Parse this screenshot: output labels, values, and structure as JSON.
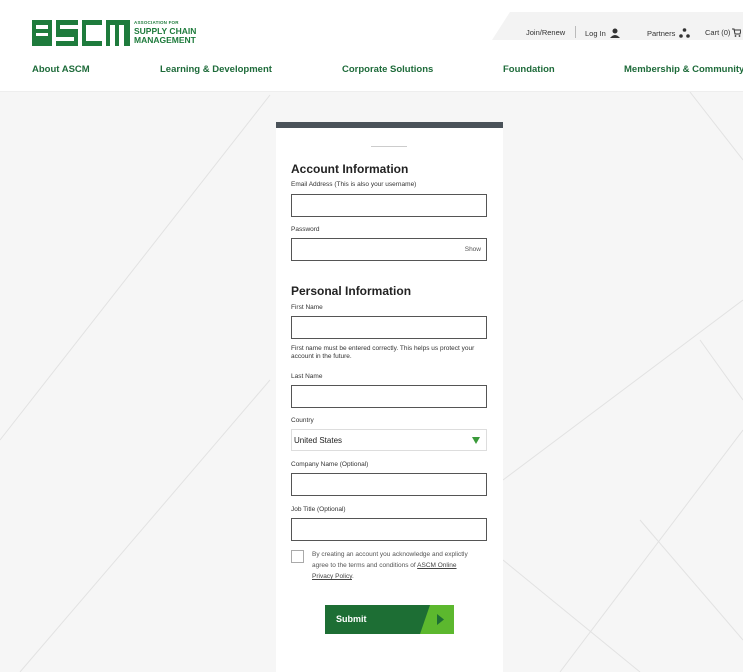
{
  "header": {
    "logo": {
      "mark_text": "ASCM",
      "line1": "ASSOCIATION FOR",
      "line2": "SUPPLY CHAIN",
      "line3": "MANAGEMENT"
    },
    "utility": {
      "join": "Join/Renew",
      "login": "Log In",
      "partners": "Partners",
      "cart": "Cart (0)"
    },
    "nav": [
      {
        "label": "About ASCM"
      },
      {
        "label": "Learning & Development"
      },
      {
        "label": "Corporate Solutions"
      },
      {
        "label": "Foundation"
      },
      {
        "label": "Membership & Community"
      }
    ]
  },
  "form": {
    "account_title": "Account Information",
    "email_label": "Email Address (This is also your username)",
    "email_value": "",
    "password_label": "Password",
    "password_value": "",
    "show_label": "Show",
    "personal_title": "Personal Information",
    "first_name_label": "First Name",
    "first_name_value": "",
    "first_name_help": "First name must be entered correctly. This helps us protect your account in the future.",
    "last_name_label": "Last Name",
    "last_name_value": "",
    "country_label": "Country",
    "country_value": "United States",
    "company_label": "Company Name (Optional)",
    "company_value": "",
    "job_title_label": "Job Title (Optional)",
    "job_title_value": "",
    "terms_text": "By creating an account you acknowledge and explictly agree to the terms and conditions of ",
    "terms_link": "ASCM Online Privacy Policy",
    "terms_end": ".",
    "submit_label": "Submit"
  },
  "colors": {
    "brand_green": "#1e7b3c",
    "nav_green": "#1e6b3a",
    "submit_green": "#1d6e34",
    "submit_accent": "#5cb82e",
    "card_top_bar": "#4a5259"
  }
}
